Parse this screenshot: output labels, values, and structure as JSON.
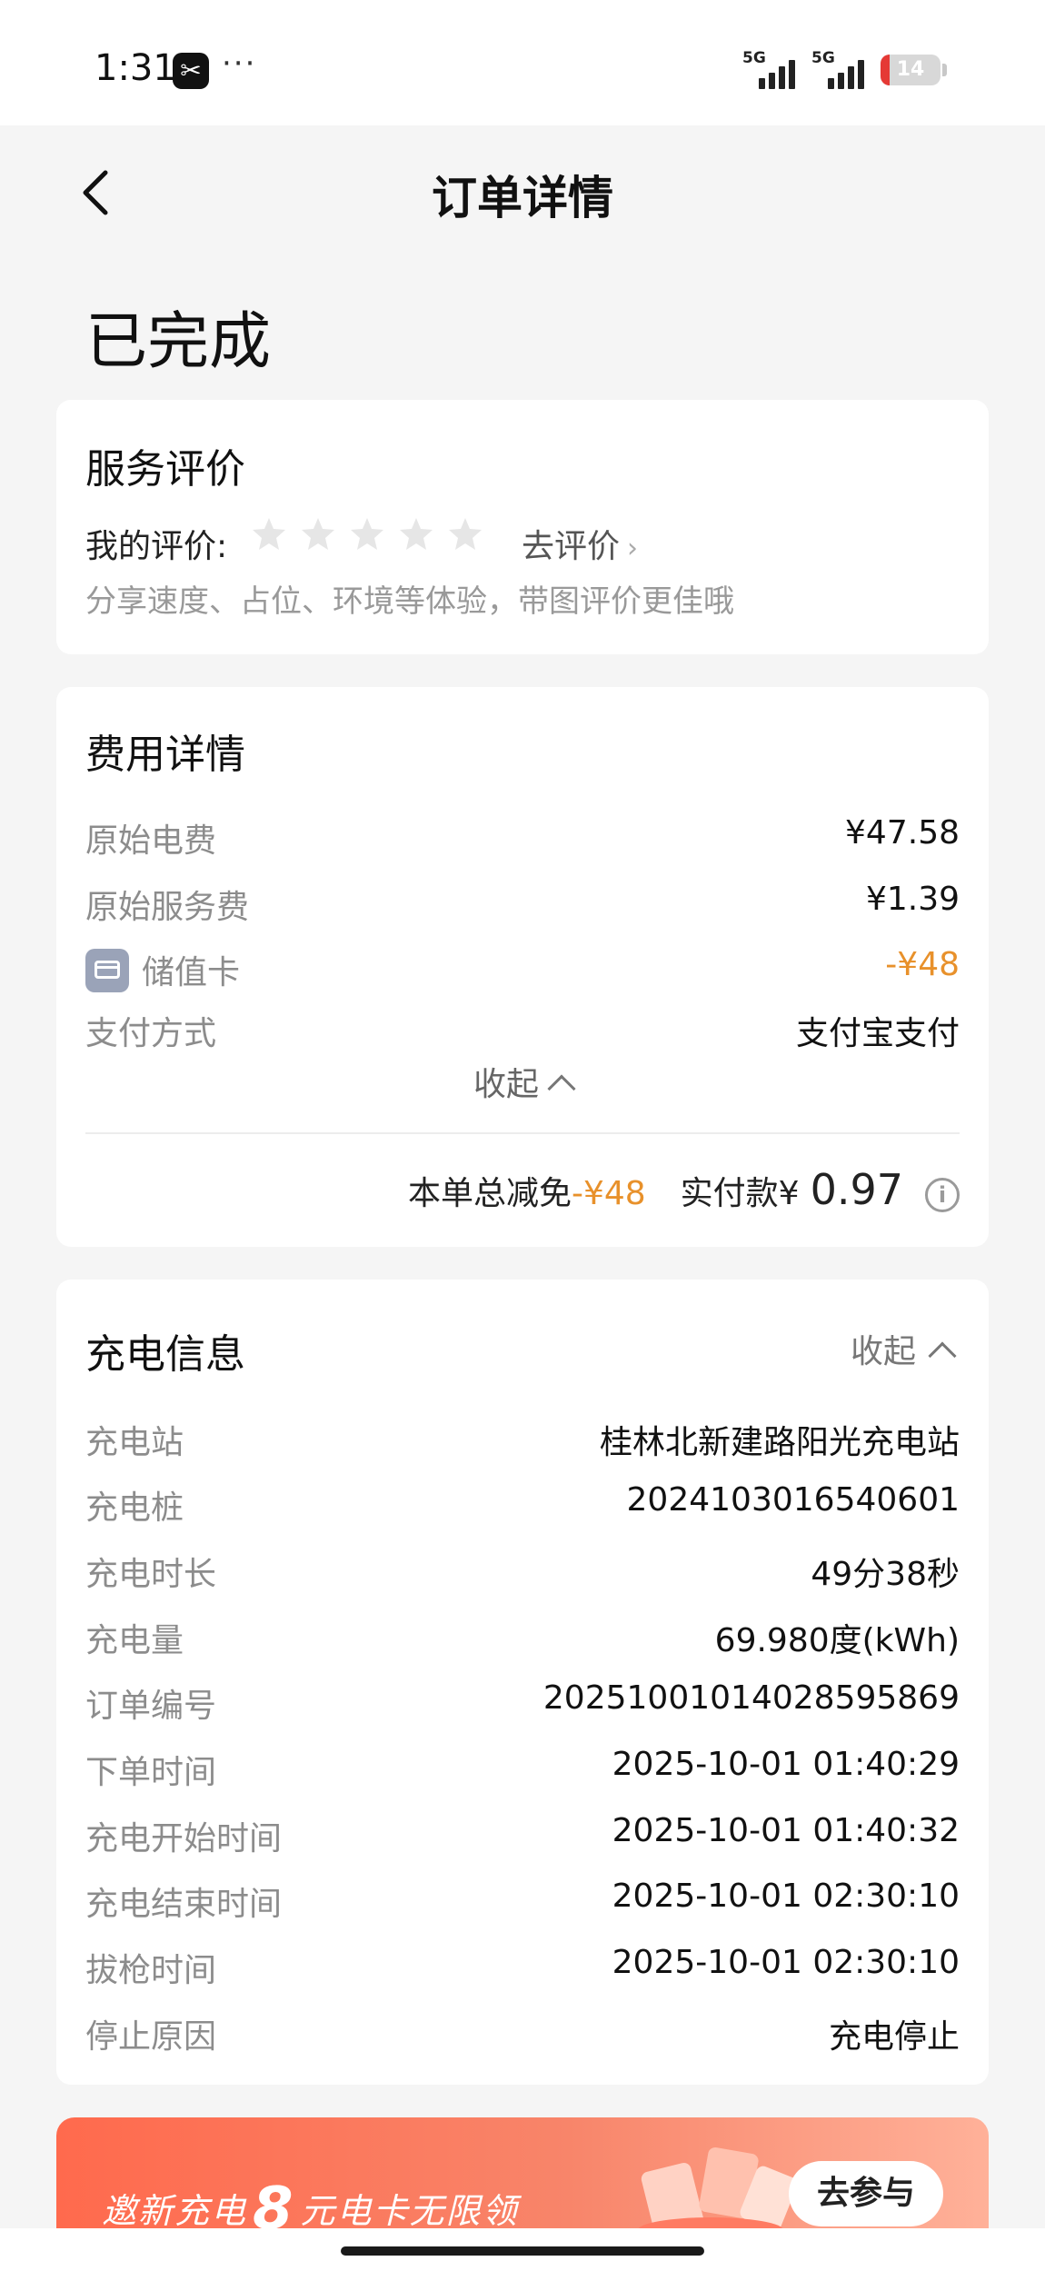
{
  "status_bar": {
    "time": "1:31",
    "app_glyph": "✂",
    "dots": "···",
    "signal1_label": "5G",
    "signal2_label": "5G",
    "battery": "14",
    "battery_color": "#e53935"
  },
  "nav": {
    "back_icon": "chevron-left-icon",
    "title": "订单详情"
  },
  "order_status": "已完成",
  "review": {
    "title": "服务评价",
    "my_review_label": "我的评价:",
    "star_count": 5,
    "stars_filled": 0,
    "go_review_label": "去评价",
    "hint": "分享速度、占位、环境等体验，带图评价更佳哦"
  },
  "fee": {
    "title": "费用详情",
    "rows": [
      {
        "label": "原始电费",
        "value": "¥47.58"
      },
      {
        "label": "原始服务费",
        "value": "¥1.39"
      },
      {
        "label": "储值卡",
        "value": "-¥48",
        "accent": "#e8912b"
      },
      {
        "label": "支付方式",
        "value": "支付宝支付"
      }
    ],
    "collapse_label": "收起",
    "total_discount_label": "本单总减免",
    "total_discount_value": "-¥48",
    "paid_label": "实付款¥",
    "paid_value": "0.97",
    "info_glyph": "i"
  },
  "charge": {
    "title": "充电信息",
    "collapse_label": "收起",
    "rows": [
      {
        "label": "充电站",
        "value": "桂林北新建路阳光充电站"
      },
      {
        "label": "充电桩",
        "value": "2024103016540601"
      },
      {
        "label": "充电时长",
        "value": "49分38秒"
      },
      {
        "label": "充电量",
        "value": "69.980度(kWh)"
      },
      {
        "label": "订单编号",
        "value": "2025100101402859586​9"
      },
      {
        "label": "下单时间",
        "value": "2025-10-01 01:40:29"
      },
      {
        "label": "充电开始时间",
        "value": "2025-10-01 01:40:32"
      },
      {
        "label": "充电结束时间",
        "value": "2025-10-01 02:30:10"
      },
      {
        "label": "拔枪时间",
        "value": "2025-10-01 02:30:10"
      },
      {
        "label": "停止原因",
        "value": "充电停止"
      }
    ]
  },
  "banner": {
    "text_before": "邀新充电",
    "number": "8",
    "text_after": "元电卡无限领",
    "button_label": "去参与",
    "gradient_start": "#ff6a4d",
    "gradient_end": "#ffb199"
  }
}
